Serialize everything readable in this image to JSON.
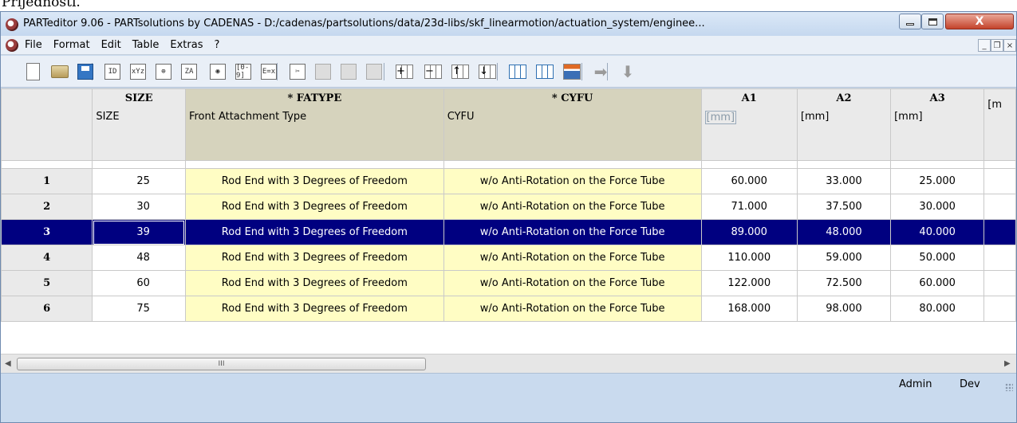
{
  "top_crop_text": "Prijednosti.",
  "window": {
    "title": "PARTeditor 9.06 - PARTsolutions by CADENAS - D:/cadenas/partsolutions/data/23d-libs/skf_linearmotion/actuation_system/enginee...",
    "close_glyph": "X"
  },
  "menu": {
    "items": [
      "File",
      "Format",
      "Edit",
      "Table",
      "Extras",
      "?"
    ],
    "mdi_min": "_",
    "mdi_restore": "❐",
    "mdi_close": "×"
  },
  "toolbar": {
    "icons": [
      {
        "name": "new-icon",
        "glyph": ""
      },
      {
        "name": "open-icon",
        "glyph": ""
      },
      {
        "name": "save-icon",
        "glyph": ""
      },
      {
        "name": "id-icon",
        "glyph": "ID"
      },
      {
        "name": "xyz-icon",
        "glyph": "xYz"
      },
      {
        "name": "geometry-icon",
        "glyph": "⊕"
      },
      {
        "name": "sort-icon",
        "glyph": "ZA"
      },
      {
        "name": "view-icon",
        "glyph": "◉"
      },
      {
        "name": "range-icon",
        "glyph": "[0-9]"
      },
      {
        "name": "formula-icon",
        "glyph": "E=x"
      },
      {
        "name": "cut-icon",
        "glyph": "✂"
      },
      {
        "name": "copy-icon",
        "glyph": ""
      },
      {
        "name": "paste-icon",
        "glyph": ""
      },
      {
        "name": "paste-special-icon",
        "glyph": ""
      },
      {
        "name": "insert-row-icon",
        "glyph": "+"
      },
      {
        "name": "delete-row-icon",
        "glyph": "−"
      },
      {
        "name": "move-row-up-icon",
        "glyph": "↑"
      },
      {
        "name": "move-row-down-icon",
        "glyph": "↓"
      },
      {
        "name": "table-view-icon",
        "glyph": ""
      },
      {
        "name": "chart-view-icon",
        "glyph": ""
      },
      {
        "name": "tree-view-icon",
        "glyph": ""
      },
      {
        "name": "arrow-right-icon",
        "glyph": "➡"
      },
      {
        "name": "arrow-down-icon",
        "glyph": "⬇"
      }
    ]
  },
  "table": {
    "columns": [
      {
        "name": "SIZE",
        "desc": "SIZE",
        "key": false
      },
      {
        "name": "* FATYPE",
        "desc": "Front Attachment Type",
        "key": true
      },
      {
        "name": "* CYFU",
        "desc": "CYFU",
        "key": true
      },
      {
        "name": "A1",
        "desc": "[mm]",
        "key": false
      },
      {
        "name": "A2",
        "desc": "[mm]",
        "key": false
      },
      {
        "name": "A3",
        "desc": "[mm]",
        "key": false
      },
      {
        "name": "",
        "desc": "[m",
        "key": false
      }
    ],
    "rows": [
      {
        "num": "1",
        "size": "25",
        "fatype": "Rod End with 3 Degrees of Freedom",
        "cyfu": "w/o Anti-Rotation on the Force Tube",
        "a1": "60.000",
        "a2": "33.000",
        "a3": "25.000",
        "selected": false
      },
      {
        "num": "2",
        "size": "30",
        "fatype": "Rod End with 3 Degrees of Freedom",
        "cyfu": "w/o Anti-Rotation on the Force Tube",
        "a1": "71.000",
        "a2": "37.500",
        "a3": "30.000",
        "selected": false
      },
      {
        "num": "3",
        "size": "39",
        "fatype": "Rod End with 3 Degrees of Freedom",
        "cyfu": "w/o Anti-Rotation on the Force Tube",
        "a1": "89.000",
        "a2": "48.000",
        "a3": "40.000",
        "selected": true
      },
      {
        "num": "4",
        "size": "48",
        "fatype": "Rod End with 3 Degrees of Freedom",
        "cyfu": "w/o Anti-Rotation on the Force Tube",
        "a1": "110.000",
        "a2": "59.000",
        "a3": "50.000",
        "selected": false
      },
      {
        "num": "5",
        "size": "60",
        "fatype": "Rod End with 3 Degrees of Freedom",
        "cyfu": "w/o Anti-Rotation on the Force Tube",
        "a1": "122.000",
        "a2": "72.500",
        "a3": "60.000",
        "selected": false
      },
      {
        "num": "6",
        "size": "75",
        "fatype": "Rod End with 3 Degrees of Freedom",
        "cyfu": "w/o Anti-Rotation on the Force Tube",
        "a1": "168.000",
        "a2": "98.000",
        "a3": "80.000",
        "selected": false
      }
    ]
  },
  "scrollbar": {
    "left_arrow": "◀",
    "right_arrow": "▶",
    "thumb_grip": "III"
  },
  "status": {
    "user": "Admin",
    "mode": "Dev"
  },
  "colors": {
    "selection": "#000080",
    "key_header": "#d6d3bd",
    "text_cell": "#fffdc4"
  }
}
